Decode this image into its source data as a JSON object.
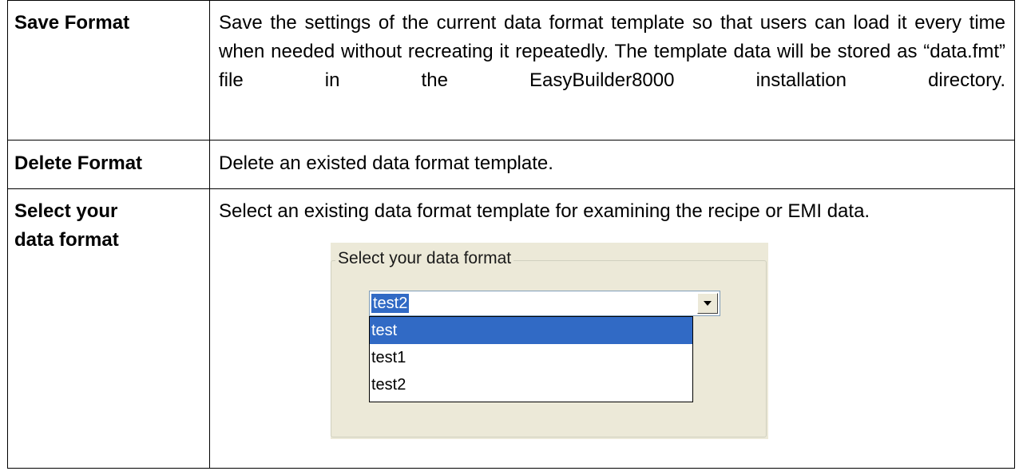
{
  "rows": [
    {
      "term": "Save Format",
      "description": "Save the settings of the current data format template so that users can load it every time when needed without recreating it repeatedly. The template data will be stored as “data.fmt” file in the EasyBuilder8000 installation directory."
    },
    {
      "term": "Delete Format",
      "description": "Delete an existed data format template."
    },
    {
      "term_line1": "Select your",
      "term_line2": "data format",
      "description": "Select an existing data format template for examining the recipe or EMI data."
    }
  ],
  "dialog": {
    "group_label": "Select your data format",
    "selected_value": "test2",
    "options": [
      "test",
      "test1",
      "test2"
    ],
    "highlighted_option": "test"
  },
  "colors": {
    "selection": "#316ac5",
    "panel_bg": "#ece9d8",
    "border": "#000000"
  }
}
